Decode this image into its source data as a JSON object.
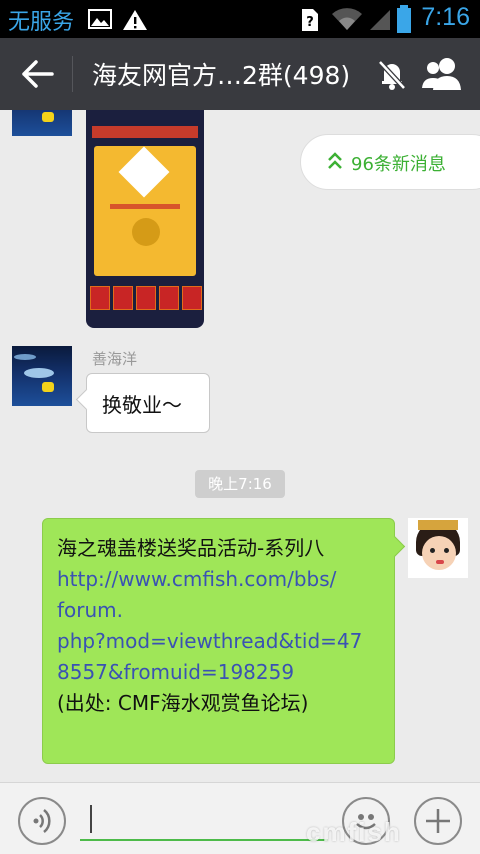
{
  "status_bar": {
    "carrier": "无服务",
    "time": "7:16",
    "icons": [
      "image-icon",
      "warning-icon",
      "sim-unknown-icon",
      "wifi-icon",
      "signal-icon",
      "battery-icon"
    ]
  },
  "header": {
    "title": "海友网官方…2群(498)",
    "icons": [
      "back-arrow-icon",
      "mute-bell-icon",
      "group-members-icon"
    ]
  },
  "new_messages_pill": {
    "label": "96条新消息",
    "icon": "double-chevron-up-icon"
  },
  "messages": {
    "incoming_name": "善海洋",
    "incoming_text": "换敬业～",
    "timestamp": "晚上7:16",
    "outgoing_lines": [
      "海之魂盖楼送奖品活动-系列八",
      "http://www.cmfish.com/bbs/",
      "forum.",
      "php?mod=viewthread&tid=47",
      "8557&fromuid=198259",
      "(出处: CMF海水观赏鱼论坛)"
    ]
  },
  "input_bar": {
    "icons": [
      "voice-icon",
      "emoji-icon",
      "plus-icon"
    ],
    "watermark": "cmfish"
  },
  "colors": {
    "accent_green": "#3cb034",
    "outgoing_bubble": "#9fe658",
    "title_bar": "#393a3f",
    "status_blue": "#3aa6e8",
    "link_blue": "#3a52b3"
  }
}
